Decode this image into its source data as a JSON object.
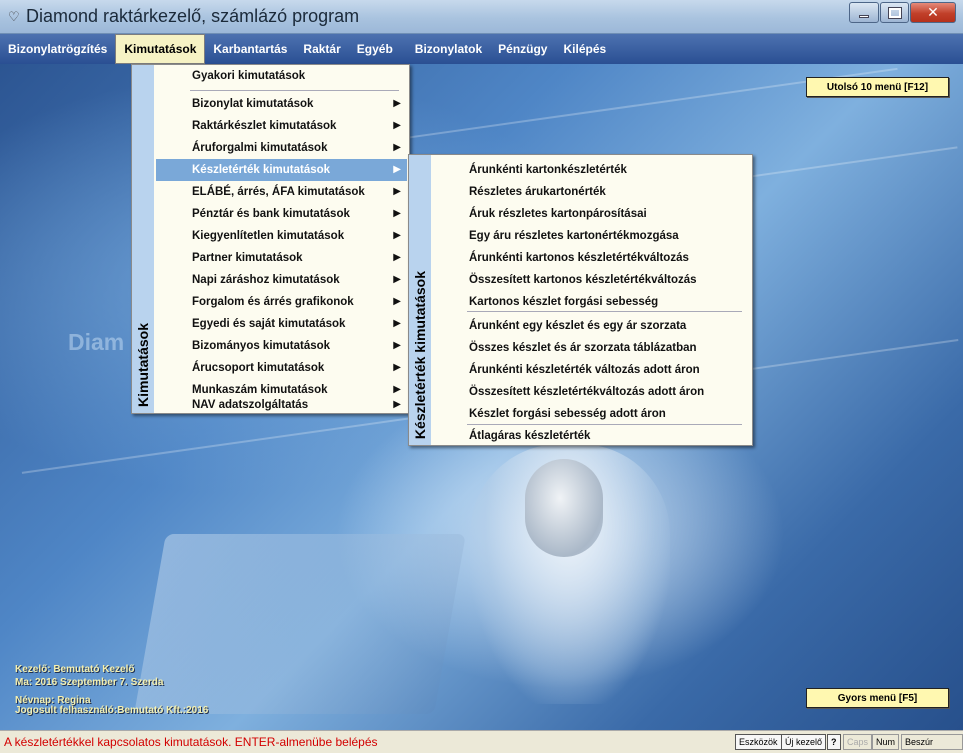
{
  "window": {
    "title": "Diamond raktárkezelő, számlázó program",
    "icon": "diamond-icon"
  },
  "menubar": [
    {
      "label": "Bizonylatrögzítés"
    },
    {
      "label": "Kimutatások"
    },
    {
      "label": "Karbantartás"
    },
    {
      "label": "Raktár"
    },
    {
      "label": "Egyéb"
    },
    {
      "label": "Bizonylatok"
    },
    {
      "label": "Pénzügy"
    },
    {
      "label": "Kilépés"
    }
  ],
  "menu1": {
    "band_label": "Kimutatások",
    "items": [
      {
        "label": "Gyakori kimutatások",
        "submenu": false
      },
      {
        "label": "Bizonylat kimutatások",
        "submenu": true
      },
      {
        "label": "Raktárkészlet kimutatások",
        "submenu": true
      },
      {
        "label": "Áruforgalmi kimutatások",
        "submenu": true
      },
      {
        "label": "Készletérték kimutatások",
        "submenu": true,
        "selected": true
      },
      {
        "label": "ELÁBÉ, árrés, ÁFA kimutatások",
        "submenu": true
      },
      {
        "label": "Pénztár és bank kimutatások",
        "submenu": true
      },
      {
        "label": "Kiegyenlítetlen kimutatások",
        "submenu": true
      },
      {
        "label": "Partner kimutatások",
        "submenu": true
      },
      {
        "label": "Napi záráshoz kimutatások",
        "submenu": true
      },
      {
        "label": "Forgalom és árrés grafikonok",
        "submenu": true
      },
      {
        "label": "Egyedi és saját kimutatások",
        "submenu": true
      },
      {
        "label": "Bizományos kimutatások",
        "submenu": true
      },
      {
        "label": "Árucsoport kimutatások",
        "submenu": true
      },
      {
        "label": "Munkaszám kimutatások",
        "submenu": true
      },
      {
        "label": "NAV adatszolgáltatás",
        "submenu": true
      }
    ],
    "arrow": "▶"
  },
  "menu2": {
    "band_label": "Készletérték kimutatások",
    "items": [
      {
        "label": "Árunkénti kartonkészletérték"
      },
      {
        "label": "Részletes árukartonérték"
      },
      {
        "label": "Áruk részletes kartonpárosításai"
      },
      {
        "label": "Egy áru részletes kartonértékmozgása"
      },
      {
        "label": "Árunkénti kartonos készletértékváltozás"
      },
      {
        "label": "Összesített kartonos készletértékváltozás"
      },
      {
        "label": "Kartonos készlet forgási sebesség"
      },
      {
        "label": "Árunként egy készlet és egy ár szorzata"
      },
      {
        "label": "Összes készlet és ár szorzata táblázatban"
      },
      {
        "label": "Árunkénti készletérték változás adott áron"
      },
      {
        "label": "Összesített készletértékváltozás adott áron"
      },
      {
        "label": "Készlet forgási sebesség adott áron"
      },
      {
        "label": "Átlagáras készletérték"
      }
    ]
  },
  "buttons": {
    "last10": "Utolsó 10 menü [F12]",
    "quick": "Gyors menü [F5]"
  },
  "background_watermark": "Diam",
  "info": {
    "operator": "Kezelő: Bemutató Kezelő",
    "date": "Ma: 2016 Szeptember  7. Szerda",
    "nameday": "Névnap: Regina",
    "licensed": "Jogosult felhasználó:Bemutató Kft.:2016"
  },
  "statusbar": {
    "text": "A készletértékkel kapcsolatos kimutatások. ENTER-almenübe belépés",
    "tools": "Eszközök",
    "new_operator": "Új kezelő",
    "help": "?",
    "caps": "Caps",
    "num": "Num",
    "insert": "Beszúr"
  }
}
